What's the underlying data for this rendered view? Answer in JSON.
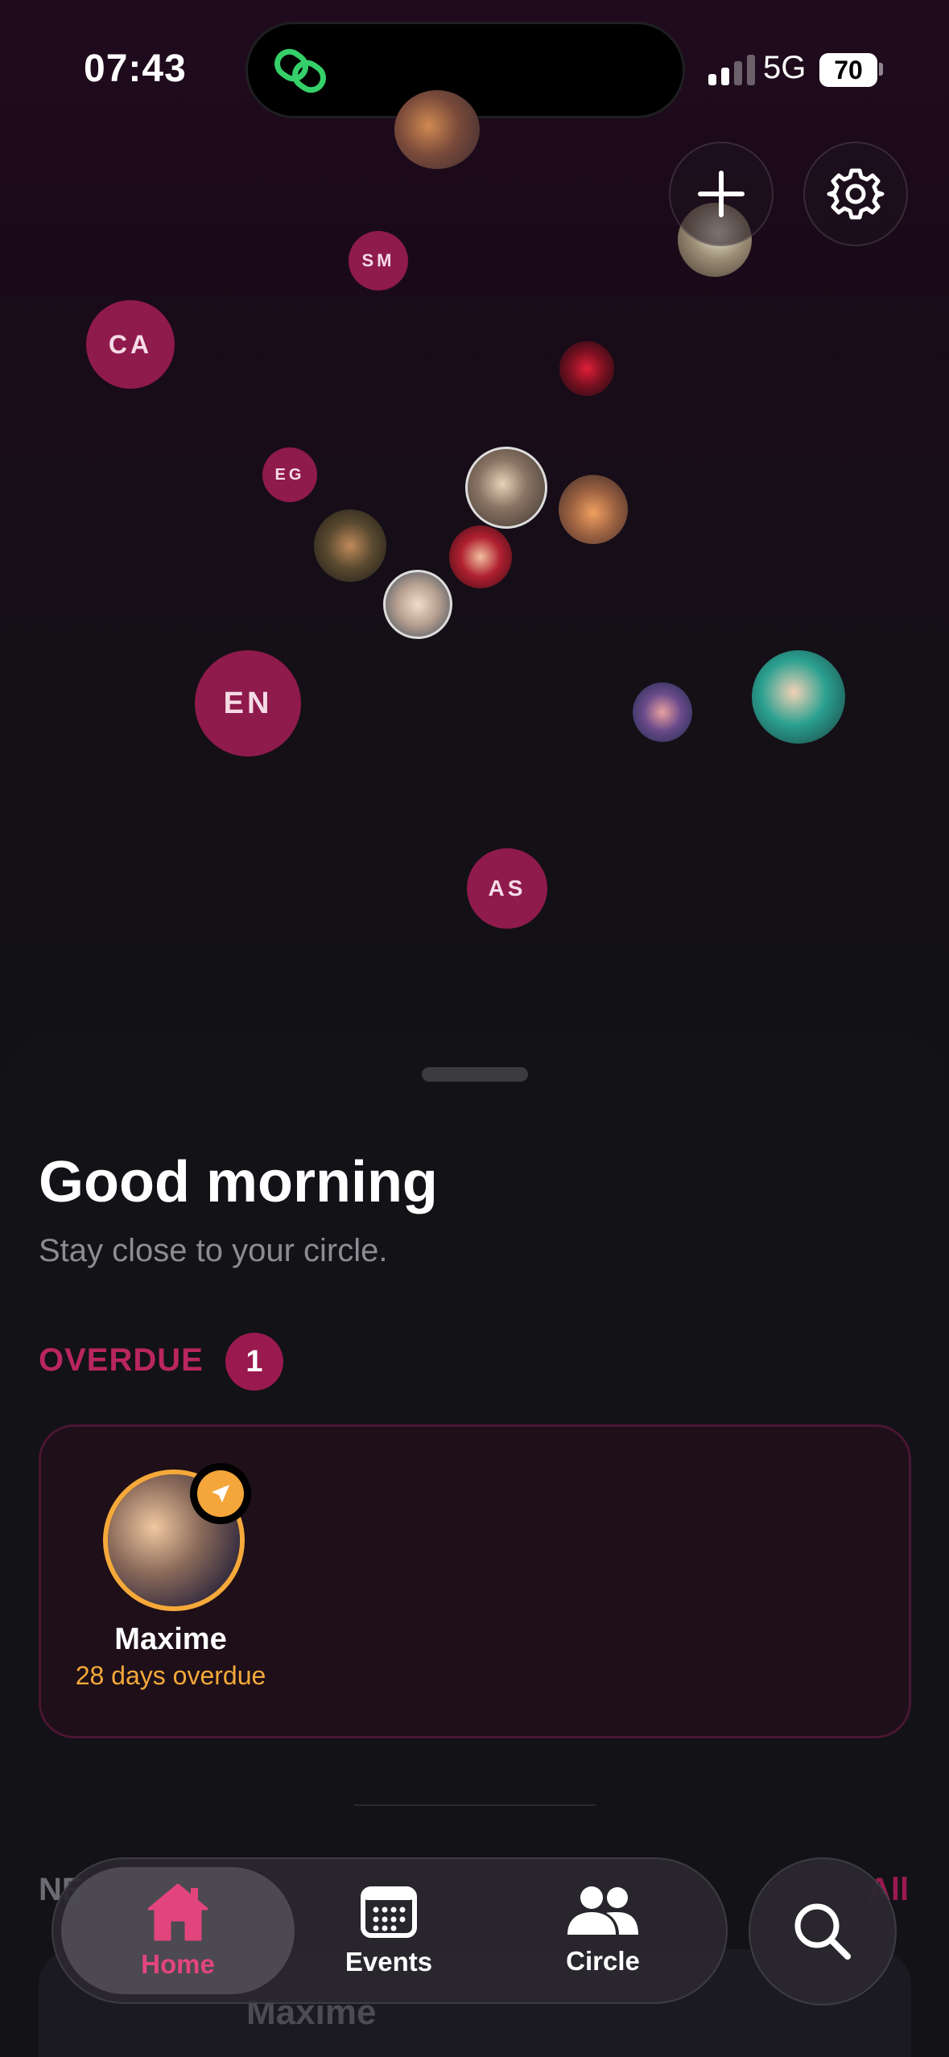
{
  "status_bar": {
    "time": "07:43",
    "network": "5G",
    "battery": "70",
    "signal_bars_active": 2,
    "signal_bars_total": 4
  },
  "top_actions": {
    "add_icon": "plus-icon",
    "settings_icon": "gear-icon"
  },
  "bubbles": [
    {
      "initials": "SM"
    },
    {
      "initials": "CA"
    },
    {
      "initials": "EG"
    },
    {
      "initials": "EN"
    },
    {
      "initials": "AS"
    }
  ],
  "home": {
    "greeting": "Good morning",
    "subtitle": "Stay close to your circle.",
    "overdue_label": "OVERDUE",
    "overdue_count": "1",
    "overdue_items": [
      {
        "name": "Maxime",
        "status": "28 days overdue",
        "badge_icon": "send-icon"
      }
    ],
    "next_label": "NE",
    "see_all": "All",
    "next_items": [
      {
        "name": "Maxime"
      }
    ]
  },
  "tabbar": {
    "tabs": [
      {
        "label": "Home",
        "icon": "home-icon",
        "active": true
      },
      {
        "label": "Events",
        "icon": "calendar-icon",
        "active": false
      },
      {
        "label": "Circle",
        "icon": "people-icon",
        "active": false
      }
    ],
    "search_icon": "search-icon"
  },
  "colors": {
    "accent": "#9a1a4f",
    "bubble": "#8f1a4c",
    "overdue_ring": "#f5a93a",
    "home_active": "#e2457c"
  }
}
